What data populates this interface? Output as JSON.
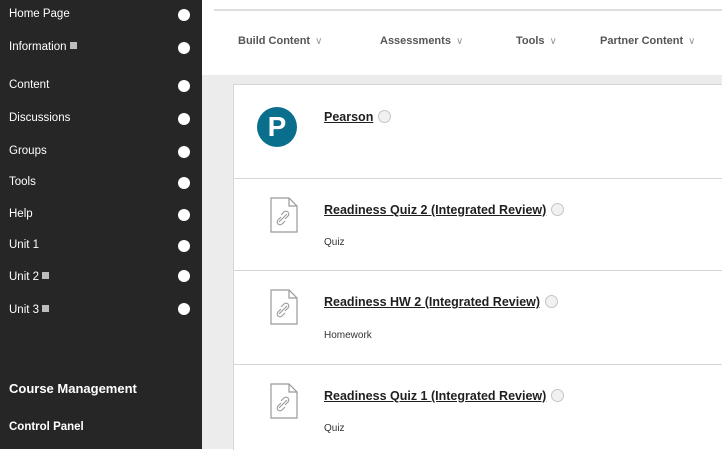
{
  "sidebar": {
    "items": [
      {
        "label": "Home Page",
        "has_badge": false
      },
      {
        "label": "Information",
        "has_badge": true
      },
      {
        "label": "Content",
        "has_badge": false
      },
      {
        "label": "Discussions",
        "has_badge": false
      },
      {
        "label": "Groups",
        "has_badge": false
      },
      {
        "label": "Tools",
        "has_badge": false
      },
      {
        "label": "Help",
        "has_badge": false
      },
      {
        "label": "Unit 1",
        "has_badge": false
      },
      {
        "label": "Unit 2",
        "has_badge": true
      },
      {
        "label": "Unit 3",
        "has_badge": true
      }
    ],
    "course_management": "Course Management",
    "control_panel": "Control Panel"
  },
  "toolbar": {
    "build_content": "Build Content",
    "assessments": "Assessments",
    "tools": "Tools",
    "partner_content": "Partner Content"
  },
  "content_items": [
    {
      "title": "Pearson",
      "description": "",
      "icon": "pearson-logo-icon"
    },
    {
      "title": "Readiness Quiz 2 (Integrated Review)",
      "description": "Quiz",
      "icon": "file-link-icon"
    },
    {
      "title": "Readiness HW 2 (Integrated Review)",
      "description": "Homework",
      "icon": "file-link-icon"
    },
    {
      "title": "Readiness Quiz 1 (Integrated Review)",
      "description": "Quiz",
      "icon": "file-link-icon"
    }
  ],
  "colors": {
    "sidebar_bg": "#262626",
    "content_bg": "#ececec",
    "pearson_blue": "#0a6f8c"
  }
}
